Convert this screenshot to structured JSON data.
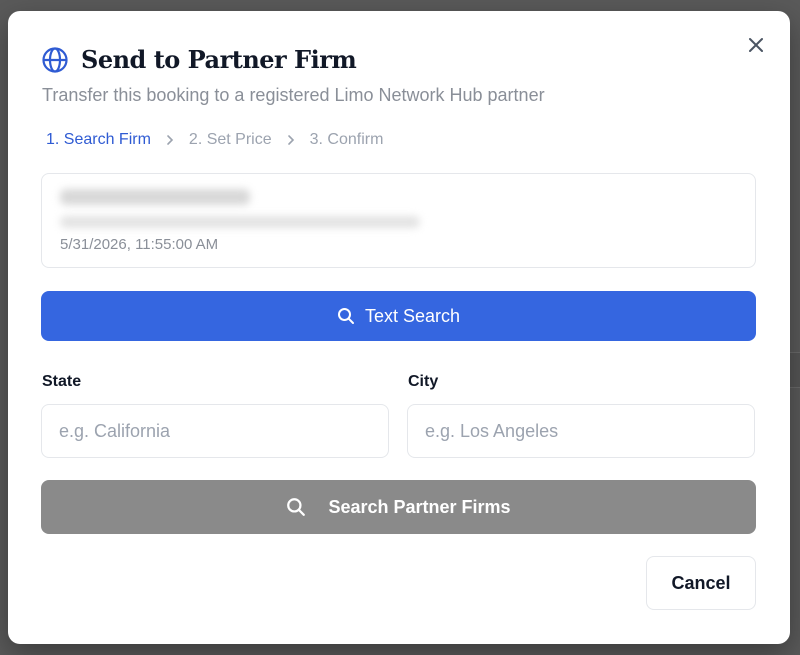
{
  "modal": {
    "title": "Send to Partner Firm",
    "subtitle": "Transfer this booking to a registered Limo Network Hub partner",
    "icon": "globe-icon",
    "accent_color": "#3566e0"
  },
  "steps": [
    {
      "label": "1. Search Firm",
      "active": true
    },
    {
      "label": "2. Set Price",
      "active": false
    },
    {
      "label": "3. Confirm",
      "active": false
    }
  ],
  "booking": {
    "datetime": "5/31/2026, 11:55:00 AM"
  },
  "text_search_button": {
    "label": "Text Search",
    "icon": "search-icon"
  },
  "fields": {
    "state": {
      "label": "State",
      "placeholder": "e.g. California",
      "value": ""
    },
    "city": {
      "label": "City",
      "placeholder": "e.g. Los Angeles",
      "value": ""
    }
  },
  "search_partner_button": {
    "label": "Search Partner Firms",
    "icon": "search-icon",
    "disabled_color": "#8a8a8a"
  },
  "cancel_button": {
    "label": "Cancel"
  }
}
